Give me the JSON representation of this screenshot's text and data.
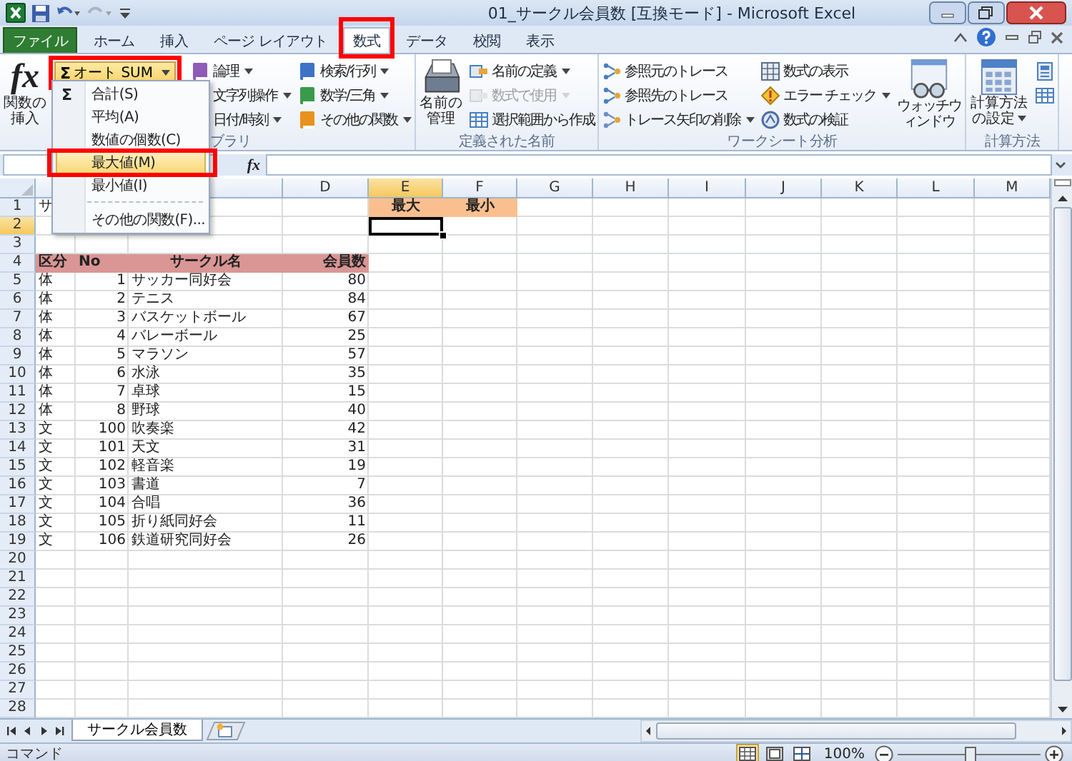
{
  "window": {
    "title": "01_サークル会員数 [互換モード] - Microsoft Excel"
  },
  "tabs": [
    {
      "label": "ファイル",
      "kind": "file",
      "selected": false,
      "callout": false
    },
    {
      "label": "ホーム",
      "kind": "tab",
      "selected": false,
      "callout": false
    },
    {
      "label": "挿入",
      "kind": "tab",
      "selected": false,
      "callout": false
    },
    {
      "label": "ページ レイアウト",
      "kind": "tab",
      "selected": false,
      "callout": false
    },
    {
      "label": "数式",
      "kind": "tab",
      "selected": true,
      "callout": true
    },
    {
      "label": "データ",
      "kind": "tab",
      "selected": false,
      "callout": false
    },
    {
      "label": "校閲",
      "kind": "tab",
      "selected": false,
      "callout": false
    },
    {
      "label": "表示",
      "kind": "tab",
      "selected": false,
      "callout": false
    }
  ],
  "ribbon": {
    "groups": [
      {
        "label": "ブラリ",
        "parts": [
          {
            "kind": "large",
            "glyph": "fx",
            "label": "関数の挿入",
            "dropdown": false
          },
          {
            "kind": "split",
            "glyph": "Σ",
            "label": "オート SUM",
            "pressed": true,
            "callout": true
          },
          {
            "kind": "column",
            "items": [
              {
                "label": "論理",
                "dropdown": true,
                "disabled": false
              },
              {
                "label": "文字列操作",
                "dropdown": true,
                "disabled": false
              },
              {
                "label": "日付/時刻",
                "dropdown": true,
                "disabled": false
              }
            ]
          },
          {
            "kind": "column",
            "items": [
              {
                "label": "検索/行列",
                "dropdown": true,
                "disabled": false
              },
              {
                "label": "数学/三角",
                "dropdown": true,
                "disabled": false
              },
              {
                "label": "その他の関数",
                "dropdown": true,
                "disabled": false
              }
            ]
          }
        ]
      },
      {
        "label": "定義された名前",
        "parts": [
          {
            "kind": "large",
            "label": "名前の管理",
            "dropdown": false
          },
          {
            "kind": "column",
            "items": [
              {
                "label": "名前の定義",
                "dropdown": true,
                "disabled": false
              },
              {
                "label": "数式で使用",
                "dropdown": true,
                "disabled": true
              },
              {
                "label": "選択範囲から作成",
                "dropdown": false,
                "disabled": false
              }
            ]
          }
        ]
      },
      {
        "label": "ワークシート分析",
        "parts": [
          {
            "kind": "column",
            "items": [
              {
                "label": "参照元のトレース",
                "dropdown": false,
                "disabled": false
              },
              {
                "label": "参照先のトレース",
                "dropdown": false,
                "disabled": false
              },
              {
                "label": "トレース矢印の削除",
                "dropdown": true,
                "disabled": false
              }
            ]
          },
          {
            "kind": "column",
            "items": [
              {
                "label": "数式の表示",
                "dropdown": false,
                "disabled": false
              },
              {
                "label": "エラー チェック",
                "dropdown": true,
                "disabled": false
              },
              {
                "label": "数式の検証",
                "dropdown": false,
                "disabled": false
              }
            ]
          },
          {
            "kind": "large",
            "label": "ウォッチウィンドウ",
            "dropdown": false
          }
        ]
      },
      {
        "label": "計算方法",
        "parts": [
          {
            "kind": "large",
            "label": "計算方法の設定",
            "dropdown": true
          },
          {
            "kind": "column",
            "items": [
              {
                "dropdown": false,
                "disabled": false
              },
              {
                "dropdown": false,
                "disabled": false
              }
            ]
          }
        ]
      }
    ]
  },
  "autosum_menu": {
    "glyph": "Σ",
    "items": [
      {
        "kind": "item",
        "label": "合計(S)",
        "selected": false,
        "callout": false
      },
      {
        "kind": "item",
        "label": "平均(A)",
        "selected": false,
        "callout": false
      },
      {
        "kind": "item",
        "label": "数値の個数(C)",
        "selected": false,
        "callout": false
      },
      {
        "kind": "item",
        "label": "最大値(M)",
        "selected": true,
        "callout": true
      },
      {
        "kind": "item",
        "label": "最小値(I)",
        "selected": false,
        "callout": false
      },
      {
        "kind": "separator"
      },
      {
        "kind": "item",
        "label": "その他の関数(F)...",
        "selected": false,
        "callout": false
      }
    ]
  },
  "formula_bar": {
    "fx": "fx"
  },
  "sheet": {
    "columns": [
      {
        "label": "D",
        "selected": false
      },
      {
        "label": "E",
        "selected": true
      },
      {
        "label": "F",
        "selected": false
      },
      {
        "label": "G",
        "selected": false
      },
      {
        "label": "H",
        "selected": false
      },
      {
        "label": "I",
        "selected": false
      },
      {
        "label": "J",
        "selected": false
      },
      {
        "label": "K",
        "selected": false
      },
      {
        "label": "L",
        "selected": false
      },
      {
        "label": "M",
        "selected": false
      }
    ],
    "rows": [
      {
        "label": "1",
        "selected": false
      },
      {
        "label": "2",
        "selected": true
      },
      {
        "label": "3",
        "selected": false
      },
      {
        "label": "4",
        "selected": false
      },
      {
        "label": "5",
        "selected": false
      },
      {
        "label": "6",
        "selected": false
      },
      {
        "label": "7",
        "selected": false
      },
      {
        "label": "8",
        "selected": false
      },
      {
        "label": "9",
        "selected": false
      },
      {
        "label": "10",
        "selected": false
      },
      {
        "label": "11",
        "selected": false
      },
      {
        "label": "12",
        "selected": false
      },
      {
        "label": "13",
        "selected": false
      },
      {
        "label": "14",
        "selected": false
      },
      {
        "label": "15",
        "selected": false
      },
      {
        "label": "16",
        "selected": false
      },
      {
        "label": "17",
        "selected": false
      },
      {
        "label": "18",
        "selected": false
      },
      {
        "label": "19",
        "selected": false
      },
      {
        "label": "20",
        "selected": false
      },
      {
        "label": "21",
        "selected": false
      },
      {
        "label": "22",
        "selected": false
      },
      {
        "label": "23",
        "selected": false
      },
      {
        "label": "24",
        "selected": false
      },
      {
        "label": "25",
        "selected": false
      },
      {
        "label": "26",
        "selected": false
      },
      {
        "label": "27",
        "selected": false
      },
      {
        "label": "28",
        "selected": false
      }
    ],
    "title_cell": "サ",
    "summary_headers": [
      "最大",
      "最小"
    ]
  },
  "table": {
    "header": [
      "区分",
      "No",
      "サークル名",
      "会員数"
    ],
    "rows": [
      [
        "体",
        "1",
        "サッカー同好会",
        "80"
      ],
      [
        "体",
        "2",
        "テニス",
        "84"
      ],
      [
        "体",
        "3",
        "バスケットボール",
        "67"
      ],
      [
        "体",
        "4",
        "バレーボール",
        "25"
      ],
      [
        "体",
        "5",
        "マラソン",
        "57"
      ],
      [
        "体",
        "6",
        "水泳",
        "35"
      ],
      [
        "体",
        "7",
        "卓球",
        "15"
      ],
      [
        "体",
        "8",
        "野球",
        "40"
      ],
      [
        "文",
        "100",
        "吹奏楽",
        "42"
      ],
      [
        "文",
        "101",
        "天文",
        "31"
      ],
      [
        "文",
        "102",
        "軽音楽",
        "19"
      ],
      [
        "文",
        "103",
        "書道",
        "7"
      ],
      [
        "文",
        "104",
        "合唱",
        "36"
      ],
      [
        "文",
        "105",
        "折り紙同好会",
        "11"
      ],
      [
        "文",
        "106",
        "鉄道研究同好会",
        "26"
      ]
    ]
  },
  "sheet_tabs": [
    {
      "label": "サークル会員数",
      "selected": true
    }
  ],
  "status_bar": {
    "mode": "コマンド",
    "views": [
      {
        "kind": "normal",
        "selected": true
      },
      {
        "kind": "page_layout",
        "selected": false
      },
      {
        "kind": "page_break",
        "selected": false
      }
    ],
    "zoom": "100%",
    "zoom_slider": {
      "level": 0.5
    }
  }
}
